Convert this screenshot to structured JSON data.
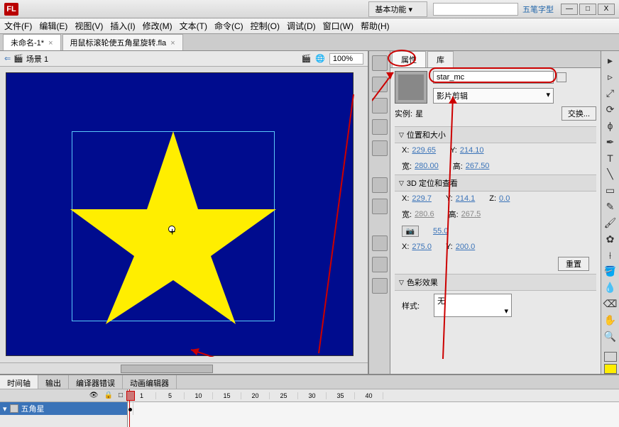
{
  "topbar": {
    "logo": "FL",
    "workspace": "基本功能",
    "ime": "五笔字型",
    "win_min": "—",
    "win_max": "□",
    "win_close": "X"
  },
  "menus": [
    "文件(F)",
    "编辑(E)",
    "视图(V)",
    "插入(I)",
    "修改(M)",
    "文本(T)",
    "命令(C)",
    "控制(O)",
    "调试(D)",
    "窗口(W)",
    "帮助(H)"
  ],
  "doc_tabs": [
    {
      "label": "未命名-1*",
      "active": true
    },
    {
      "label": "用鼠标滚轮使五角星旋转.fla",
      "active": false
    }
  ],
  "scene_bar": {
    "arrow": "⇐",
    "icon": "🎬",
    "name": "场景 1",
    "clapper": "🎬",
    "globe": "🌐",
    "zoom": "100%"
  },
  "props": {
    "tab_properties": "属性",
    "tab_library": "库",
    "instance_name": "star_mc",
    "type": "影片剪辑",
    "instance_label": "实例:",
    "instance_value": "星",
    "swap": "交换...",
    "sec_position": "位置和大小",
    "x_label": "X:",
    "x": "229.65",
    "y_label": "Y:",
    "y": "214.10",
    "w_label": "宽:",
    "w": "280.00",
    "h_label": "高:",
    "h": "267.50",
    "sec_3d": "3D 定位和查看",
    "x3_label": "X:",
    "x3": "229.7",
    "y3_label": "Y:",
    "y3": "214.1",
    "z3_label": "Z:",
    "z3": "0.0",
    "w3_label": "宽:",
    "w3": "280.6",
    "h3_label": "高:",
    "h3": "267.5",
    "persp": "55.0",
    "vx_label": "X:",
    "vx": "275.0",
    "vy_label": "Y:",
    "vy": "200.0",
    "reset": "重置",
    "sec_color": "色彩效果",
    "style_label": "样式:",
    "style_value": "无"
  },
  "timeline": {
    "tabs": [
      "时间轴",
      "输出",
      "编译器错误",
      "动画编辑器"
    ],
    "layer": "五角星",
    "eye": "👁",
    "lock": "🔒",
    "outline": "□",
    "ruler": [
      "1",
      "5",
      "10",
      "15",
      "20",
      "25",
      "30",
      "35",
      "40"
    ]
  },
  "colors": {
    "stroke": "#000000",
    "fill": "#ffee00"
  }
}
